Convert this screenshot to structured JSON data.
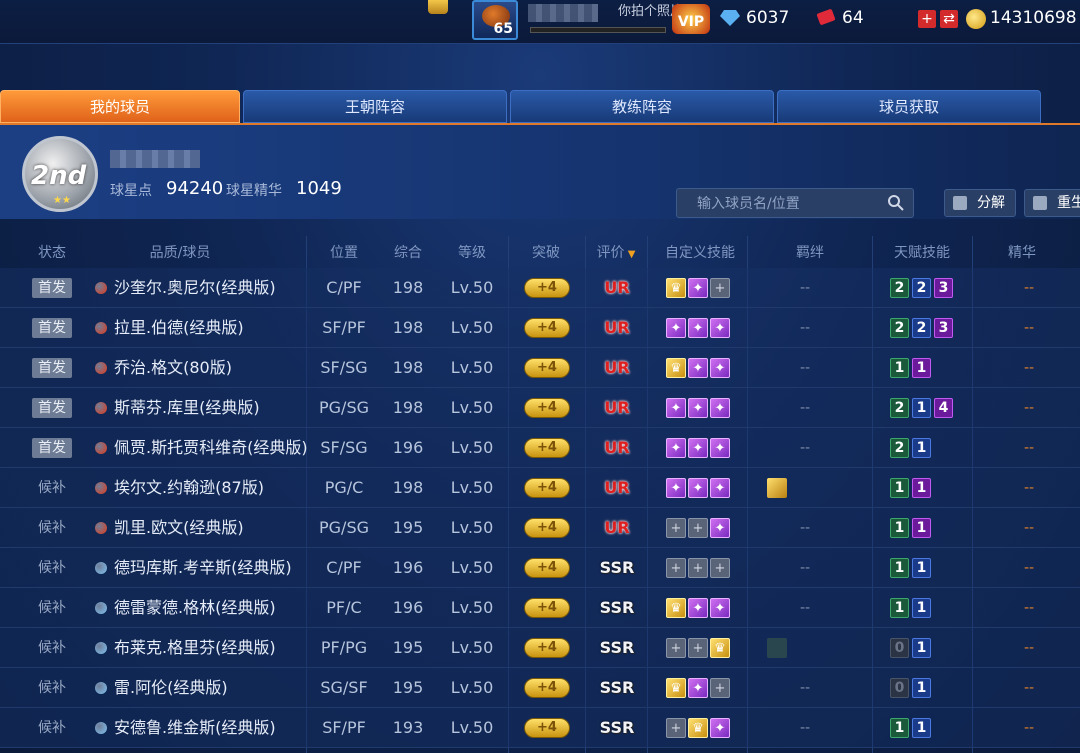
{
  "topbar": {
    "level": "65",
    "photo_text": "你拍个照片",
    "vip_label": "VIP",
    "diamonds": "6037",
    "tickets": "64",
    "gold": "14310698"
  },
  "tabs": [
    {
      "label": "我的球员",
      "active": true
    },
    {
      "label": "王朝阵容",
      "active": false
    },
    {
      "label": "教练阵容",
      "active": false
    },
    {
      "label": "球员获取",
      "active": false
    }
  ],
  "info": {
    "rank": "2nd",
    "star_points_label": "球星点",
    "star_points": "94240",
    "essence_label": "球星精华",
    "essence": "1049",
    "search_placeholder": "输入球员名/位置",
    "decompose_label": "分解",
    "rebirth_label": "重生"
  },
  "headers": {
    "status": "状态",
    "quality": "品质/球员",
    "position": "位置",
    "overall": "综合",
    "level": "等级",
    "breakthrough": "突破",
    "rating": "评价",
    "custom_skills": "自定义技能",
    "bonds": "羁绊",
    "talent": "天赋技能",
    "essence": "精华"
  },
  "players": [
    {
      "status": "首发",
      "starter": true,
      "quality": "red",
      "name": "沙奎尔.奥尼尔(经典版)",
      "pos": "C/PF",
      "ovr": "198",
      "lvl": "Lv.50",
      "brk": "+4",
      "rating": "UR",
      "skills": [
        "gold",
        "purple",
        "empty"
      ],
      "bond": "--",
      "talents": [
        [
          "g",
          "2"
        ],
        [
          "b",
          "2"
        ],
        [
          "p",
          "3"
        ]
      ],
      "essence": "--"
    },
    {
      "status": "首发",
      "starter": true,
      "quality": "red",
      "name": "拉里.伯德(经典版)",
      "pos": "SF/PF",
      "ovr": "198",
      "lvl": "Lv.50",
      "brk": "+4",
      "rating": "UR",
      "skills": [
        "purple",
        "purple",
        "purple"
      ],
      "bond": "--",
      "talents": [
        [
          "g",
          "2"
        ],
        [
          "b",
          "2"
        ],
        [
          "p",
          "3"
        ]
      ],
      "essence": "--"
    },
    {
      "status": "首发",
      "starter": true,
      "quality": "red",
      "name": "乔治.格文(80版)",
      "pos": "SF/SG",
      "ovr": "198",
      "lvl": "Lv.50",
      "brk": "+4",
      "rating": "UR",
      "skills": [
        "gold",
        "purple",
        "purple"
      ],
      "bond": "--",
      "talents": [
        [
          "g",
          "1"
        ],
        [
          "p",
          "1"
        ]
      ],
      "essence": "--"
    },
    {
      "status": "首发",
      "starter": true,
      "quality": "red",
      "name": "斯蒂芬.库里(经典版)",
      "pos": "PG/SG",
      "ovr": "198",
      "lvl": "Lv.50",
      "brk": "+4",
      "rating": "UR",
      "skills": [
        "purple",
        "purple",
        "purple"
      ],
      "bond": "--",
      "talents": [
        [
          "g",
          "2"
        ],
        [
          "b",
          "1"
        ],
        [
          "p",
          "4"
        ]
      ],
      "essence": "--"
    },
    {
      "status": "首发",
      "starter": true,
      "quality": "red",
      "name": "佩贾.斯托贾科维奇(经典版)",
      "pos": "SF/SG",
      "ovr": "196",
      "lvl": "Lv.50",
      "brk": "+4",
      "rating": "UR",
      "skills": [
        "purple",
        "purple",
        "purple"
      ],
      "bond": "--",
      "talents": [
        [
          "g",
          "2"
        ],
        [
          "b",
          "1"
        ]
      ],
      "essence": "--"
    },
    {
      "status": "候补",
      "starter": false,
      "quality": "red",
      "name": "埃尔文.约翰逊(87版)",
      "pos": "PG/C",
      "ovr": "198",
      "lvl": "Lv.50",
      "brk": "+4",
      "rating": "UR",
      "skills": [
        "purple",
        "purple",
        "purple"
      ],
      "bond": "gold",
      "talents": [
        [
          "g",
          "1"
        ],
        [
          "p",
          "1"
        ]
      ],
      "essence": "--"
    },
    {
      "status": "候补",
      "starter": false,
      "quality": "red",
      "name": "凯里.欧文(经典版)",
      "pos": "PG/SG",
      "ovr": "195",
      "lvl": "Lv.50",
      "brk": "+4",
      "rating": "UR",
      "skills": [
        "empty",
        "empty",
        "purple"
      ],
      "bond": "--",
      "talents": [
        [
          "g",
          "1"
        ],
        [
          "p",
          "1"
        ]
      ],
      "essence": "--"
    },
    {
      "status": "候补",
      "starter": false,
      "quality": "blue",
      "name": "德玛库斯.考辛斯(经典版)",
      "pos": "C/PF",
      "ovr": "196",
      "lvl": "Lv.50",
      "brk": "+4",
      "rating": "SSR",
      "skills": [
        "empty",
        "empty",
        "empty"
      ],
      "bond": "--",
      "talents": [
        [
          "g",
          "1"
        ],
        [
          "b",
          "1"
        ]
      ],
      "essence": "--"
    },
    {
      "status": "候补",
      "starter": false,
      "quality": "blue",
      "name": "德雷蒙德.格林(经典版)",
      "pos": "PF/C",
      "ovr": "196",
      "lvl": "Lv.50",
      "brk": "+4",
      "rating": "SSR",
      "skills": [
        "gold",
        "purple",
        "purple"
      ],
      "bond": "--",
      "talents": [
        [
          "g",
          "1"
        ],
        [
          "b",
          "1"
        ]
      ],
      "essence": "--"
    },
    {
      "status": "候补",
      "starter": false,
      "quality": "blue",
      "name": "布莱克.格里芬(经典版)",
      "pos": "PF/PG",
      "ovr": "195",
      "lvl": "Lv.50",
      "brk": "+4",
      "rating": "SSR",
      "skills": [
        "empty",
        "empty",
        "gold"
      ],
      "bond": "dim",
      "talents": [
        [
          "z",
          "0"
        ],
        [
          "b",
          "1"
        ]
      ],
      "essence": "--"
    },
    {
      "status": "候补",
      "starter": false,
      "quality": "blue",
      "name": "雷.阿伦(经典版)",
      "pos": "SG/SF",
      "ovr": "195",
      "lvl": "Lv.50",
      "brk": "+4",
      "rating": "SSR",
      "skills": [
        "gold",
        "purple",
        "empty"
      ],
      "bond": "--",
      "talents": [
        [
          "z",
          "0"
        ],
        [
          "b",
          "1"
        ]
      ],
      "essence": "--"
    },
    {
      "status": "候补",
      "starter": false,
      "quality": "blue",
      "name": "安德鲁.维金斯(经典版)",
      "pos": "SF/PF",
      "ovr": "193",
      "lvl": "Lv.50",
      "brk": "+4",
      "rating": "SSR",
      "skills": [
        "empty",
        "gold",
        "purple"
      ],
      "bond": "--",
      "talents": [
        [
          "g",
          "1"
        ],
        [
          "b",
          "1"
        ]
      ],
      "essence": "--"
    }
  ],
  "colors": {
    "accent": "#e07a2a",
    "ur": "#e02020",
    "red_quality": "#e03a1a",
    "blue_quality": "#7ec0f0"
  }
}
